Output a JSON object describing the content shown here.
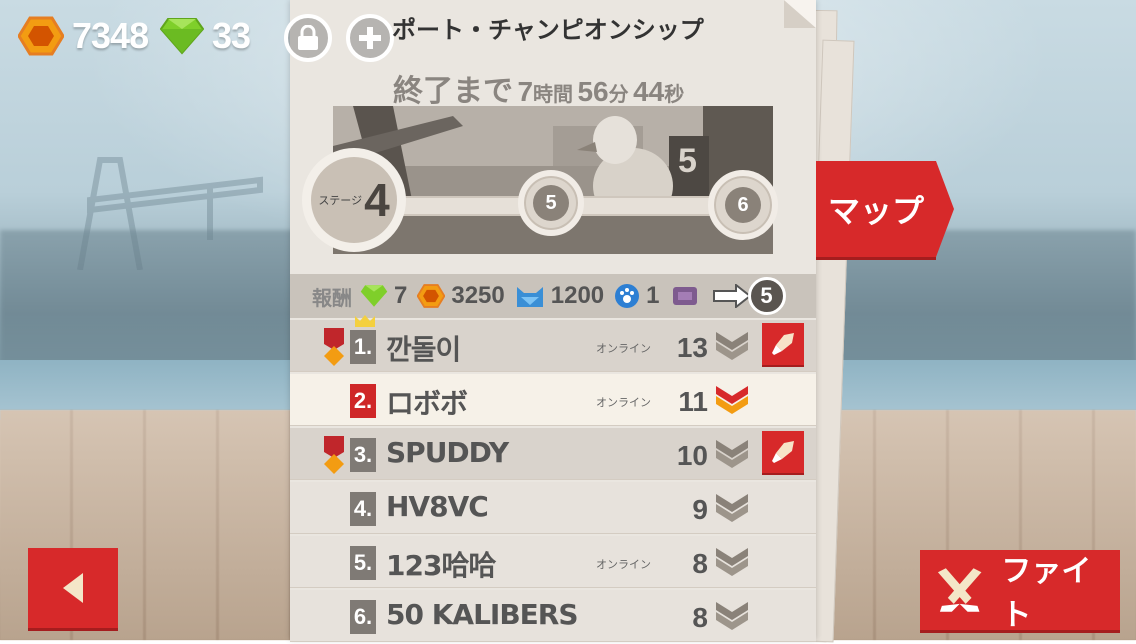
{
  "hud": {
    "honey": "7348",
    "gems": "33"
  },
  "event": {
    "title": "ポート・チャンピオンシップ",
    "timer_label": "終了まで",
    "hours": "7",
    "hours_unit": "時間",
    "minutes": "56",
    "minutes_unit": "分",
    "seconds": "44",
    "seconds_unit": "秒"
  },
  "stages": {
    "label": "ステージ",
    "current": "4",
    "next": [
      "5",
      "6"
    ]
  },
  "map_button": "マップ",
  "rewards": {
    "label": "報酬",
    "items": [
      {
        "icon": "gem-icon",
        "value": "7"
      },
      {
        "icon": "honey-icon",
        "value": "3250"
      },
      {
        "icon": "cat-food-icon",
        "value": "1200"
      },
      {
        "icon": "paw-token-icon",
        "value": "1"
      },
      {
        "icon": "crate-icon",
        "value": ""
      }
    ],
    "next_count": "5"
  },
  "leaderboard": [
    {
      "rank": "1.",
      "name": "깐돌이",
      "status": "オンライン",
      "score": "13",
      "medal": true,
      "crown": true,
      "me": false,
      "attack": true
    },
    {
      "rank": "2.",
      "name": "ロボボ",
      "status": "オンライン",
      "score": "11",
      "medal": false,
      "crown": false,
      "me": true,
      "attack": false
    },
    {
      "rank": "3.",
      "name": "SPUDDY",
      "status": "",
      "score": "10",
      "medal": true,
      "crown": false,
      "me": false,
      "attack": true
    },
    {
      "rank": "4.",
      "name": "HV8VC",
      "status": "",
      "score": "9",
      "medal": false,
      "crown": false,
      "me": false,
      "attack": false
    },
    {
      "rank": "5.",
      "name": "123哈哈",
      "status": "オンライン",
      "score": "8",
      "medal": false,
      "crown": false,
      "me": false,
      "attack": false
    },
    {
      "rank": "6.",
      "name": "50 KALIBERS",
      "status": "",
      "score": "8",
      "medal": false,
      "crown": false,
      "me": false,
      "attack": false
    }
  ],
  "fight_button": "ファイト",
  "colors": {
    "accent_red": "#d7292a",
    "honey": "#f39c12",
    "gem": "#7fcf2a",
    "panel": "#eae6e0"
  }
}
